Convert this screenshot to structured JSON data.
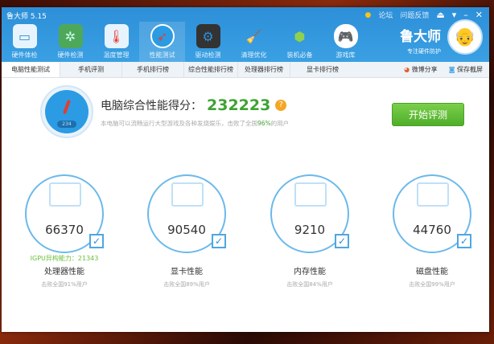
{
  "window": {
    "title": "鲁大师 5.15",
    "links": [
      "论坛",
      "问题反馈"
    ],
    "controls": [
      "skin-icon",
      "menu-icon",
      "minimize",
      "close"
    ]
  },
  "toolbar": [
    {
      "label": "硬件体检",
      "icon": "monitor-icon"
    },
    {
      "label": "硬件检测",
      "icon": "board-icon"
    },
    {
      "label": "温度管理",
      "icon": "thermometer-icon"
    },
    {
      "label": "性能测试",
      "icon": "gauge-icon"
    },
    {
      "label": "驱动检测",
      "icon": "driver-icon"
    },
    {
      "label": "清理优化",
      "icon": "broom-icon"
    },
    {
      "label": "装机必备",
      "icon": "box-icon"
    },
    {
      "label": "游戏库",
      "icon": "gamepad-icon"
    }
  ],
  "brand": {
    "name": "鲁大师",
    "slogan": "专注硬件防护"
  },
  "tabs": [
    "电脑性能测试",
    "手机评测",
    "手机排行榜",
    "综合性能排行榜",
    "处理器排行榜",
    "显卡排行榜"
  ],
  "tab_actions": [
    "微博分享",
    "保存截屏"
  ],
  "summary": {
    "gauge_number": "234",
    "label": "电脑综合性能得分：",
    "score": "232223",
    "desc_pre": "本电脑可以流畅运行大型游戏及各种发烧娱乐，击败了全国",
    "desc_pct": "96%",
    "desc_post": "的用户",
    "start_button": "开始评测"
  },
  "cards": [
    {
      "value": "66370",
      "extra": "IGPU异构能力：21343",
      "label": "处理器性能",
      "sub": "击败全国91%用户"
    },
    {
      "value": "90540",
      "extra": "",
      "label": "显卡性能",
      "sub": "击败全国89%用户"
    },
    {
      "value": "9210",
      "extra": "",
      "label": "内存性能",
      "sub": "击败全国84%用户"
    },
    {
      "value": "44760",
      "extra": "",
      "label": "磁盘性能",
      "sub": "击败全国99%用户"
    }
  ]
}
